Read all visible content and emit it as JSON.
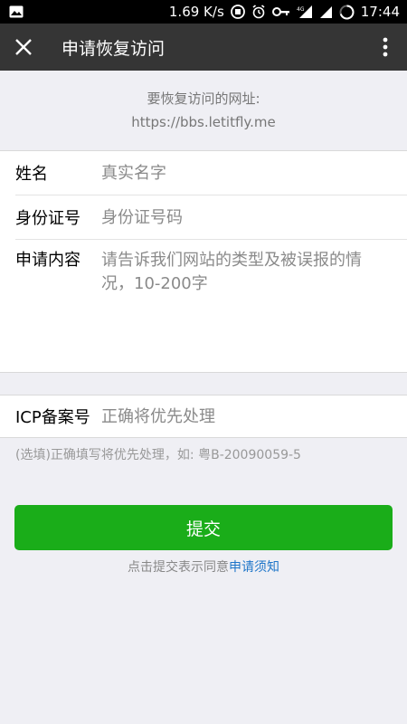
{
  "status_bar": {
    "speed": "1.69 K/s",
    "time": "17:44",
    "network_label": "4G"
  },
  "header": {
    "title": "申请恢复访问"
  },
  "site_info": {
    "label": "要恢复访问的网址:",
    "url": "https://bbs.letitfly.me"
  },
  "form": {
    "name": {
      "label": "姓名",
      "placeholder": "真实名字"
    },
    "id_number": {
      "label": "身份证号",
      "placeholder": "身份证号码"
    },
    "content": {
      "label": "申请内容",
      "placeholder": "请告诉我们网站的类型及被误报的情况，10-200字"
    },
    "icp": {
      "label": "ICP备案号",
      "placeholder": "正确将优先处理"
    },
    "icp_hint": "(选填)正确填写将优先处理，如: 粤B-20090059-5"
  },
  "submit": {
    "label": "提交",
    "agree_prefix": "点击提交表示同意",
    "agree_link": "申请须知"
  },
  "colors": {
    "accent_green": "#1aad19",
    "link_blue": "#1f76c9",
    "header_bg": "#353535"
  }
}
